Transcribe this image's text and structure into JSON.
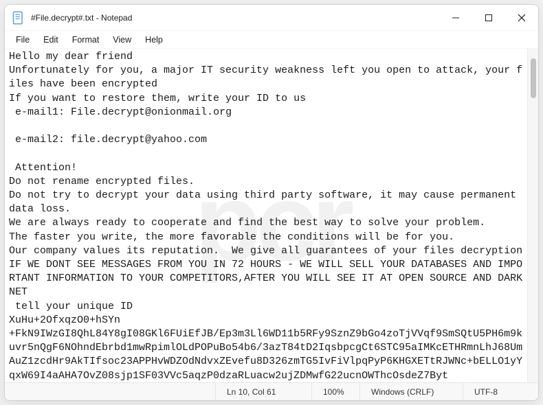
{
  "window": {
    "title": "#File.decrypt#.txt - Notepad"
  },
  "menu": {
    "file": "File",
    "edit": "Edit",
    "format": "Format",
    "view": "View",
    "help": "Help"
  },
  "body_text": "Hello my dear friend\nUnfortunately for you, a major IT security weakness left you open to attack, your files have been encrypted\nIf you want to restore them, write your ID to us\n e-mail1: File.decrypt@onionmail.org\n\n e-mail2: file.decrypt@yahoo.com\n\n Attention!\nDo not rename encrypted files.\nDo not try to decrypt your data using third party software, it may cause permanent data loss.\nWe are always ready to cooperate and find the best way to solve your problem.\nThe faster you write, the more favorable the conditions will be for you.\nOur company values its reputation.  We give all guarantees of your files decryption\nIF WE DONT SEE MESSAGES FROM YOU IN 72 HOURS - WE WILL SELL YOUR DATABASES AND IMPORTANT INFORMATION TO YOUR COMPETITORS,AFTER YOU WILL SEE IT AT OPEN SOURCE AND DARKNET\n tell your unique ID\nXuHu+2OfxqzO0+hSYn\n+FkN9IWzGI8QhL84Y8gI08GKl6FUiEfJB/Ep3m3Ll6WD11b5RFy9SznZ9bGo4zoTjVVqf9SmSQtU5PH6m9kuvr5nQgF6NOhndEbrbd1mwRpimlOLdPOPuBo54b6/3azT84tD2IqsbpcgCt6STC95aIMKcETHRmnLhJ68UmAuZ1zcdHr9AkTIfsoc23APPHvWDZOdNdvxZEvefu8D326zmTG5IvFiVlpqPyP6KHGXETtRJWNc+bELLO1yYqxW69I4aAHA7OvZ08sjp1SF03VVc5aqzP0dzaRLuacw2ujZDMwfG22ucnOWThcOsdeZ7Byt",
  "status": {
    "position": "Ln 10, Col 61",
    "zoom": "100%",
    "eol": "Windows (CRLF)",
    "encoding": "UTF-8"
  },
  "watermark": "pcr"
}
